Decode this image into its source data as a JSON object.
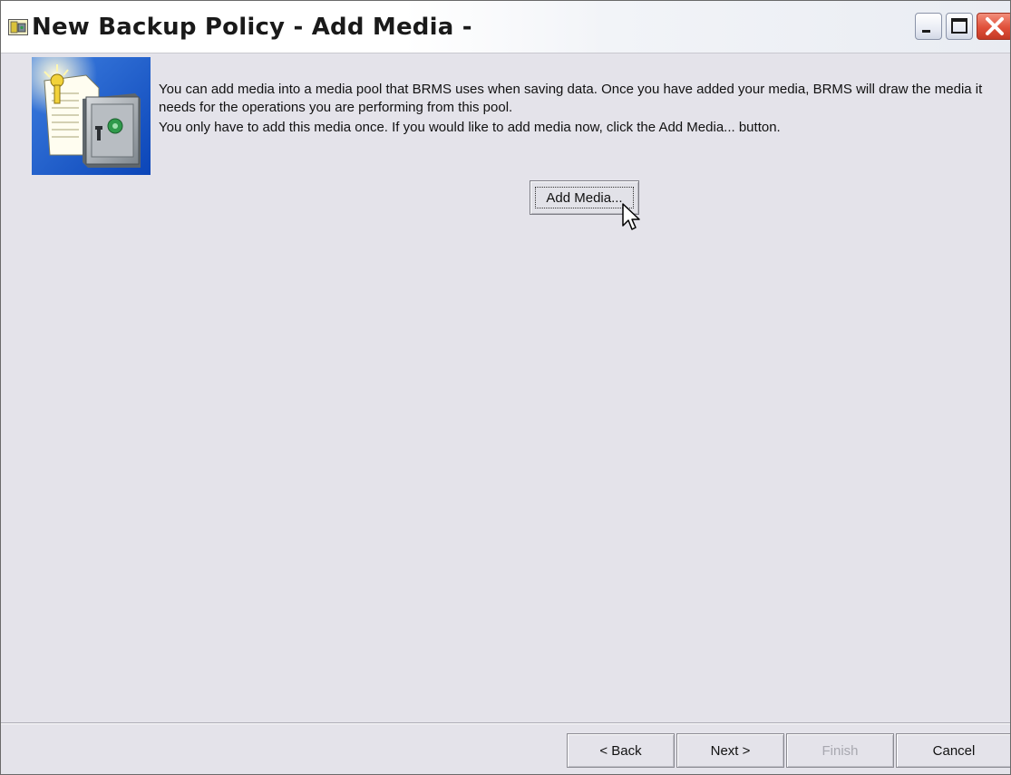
{
  "window": {
    "title": "New Backup Policy - Add Media -",
    "controls": {
      "minimize_icon": "minimize-icon",
      "maximize_icon": "maximize-icon",
      "close_icon": "close-icon"
    }
  },
  "content": {
    "image_icon": "media-safe-icon",
    "paragraph_1": "You can add media into a media pool that BRMS uses when saving data. Once you have added your media, BRMS will draw the media it needs for the operations you are performing from this pool.",
    "paragraph_2": "You only have to add this media once. If you would like to add media now, click the Add Media... button.",
    "add_media_label": "Add Media..."
  },
  "footer": {
    "back_label": "< Back",
    "next_label": "Next >",
    "finish_label": "Finish",
    "cancel_label": "Cancel",
    "finish_enabled": false
  },
  "colors": {
    "dialog_background": "#e4e3ea",
    "close_button": "#e0503a",
    "disabled_text": "#a8a8b0"
  }
}
